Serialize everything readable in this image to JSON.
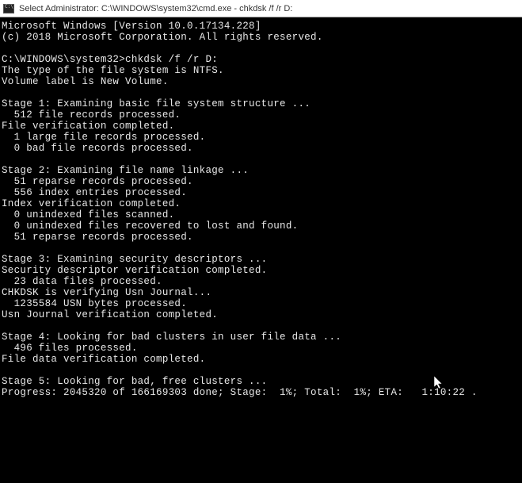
{
  "titlebar": {
    "text": "Select Administrator: C:\\WINDOWS\\system32\\cmd.exe - chkdsk  /f /r D:"
  },
  "console": {
    "line1": "Microsoft Windows [Version 10.0.17134.228]",
    "line2": "(c) 2018 Microsoft Corporation. All rights reserved.",
    "blank1": "",
    "prompt": "C:\\WINDOWS\\system32>chkdsk /f /r D:",
    "fs_type": "The type of the file system is NTFS.",
    "vol_label": "Volume label is New Volume.",
    "blank2": "",
    "stage1_header": "Stage 1: Examining basic file system structure ...",
    "stage1_l1": "  512 file records processed.",
    "stage1_l2": "File verification completed.",
    "stage1_l3": "  1 large file records processed.",
    "stage1_l4": "  0 bad file records processed.",
    "blank3": "",
    "stage2_header": "Stage 2: Examining file name linkage ...",
    "stage2_l1": "  51 reparse records processed.",
    "stage2_l2": "  556 index entries processed.",
    "stage2_l3": "Index verification completed.",
    "stage2_l4": "  0 unindexed files scanned.",
    "stage2_l5": "  0 unindexed files recovered to lost and found.",
    "stage2_l6": "  51 reparse records processed.",
    "blank4": "",
    "stage3_header": "Stage 3: Examining security descriptors ...",
    "stage3_l1": "Security descriptor verification completed.",
    "stage3_l2": "  23 data files processed.",
    "stage3_l3": "CHKDSK is verifying Usn Journal...",
    "stage3_l4": "  1235584 USN bytes processed.",
    "stage3_l5": "Usn Journal verification completed.",
    "blank5": "",
    "stage4_header": "Stage 4: Looking for bad clusters in user file data ...",
    "stage4_l1": "  496 files processed.",
    "stage4_l2": "File data verification completed.",
    "blank6": "",
    "stage5_header": "Stage 5: Looking for bad, free clusters ...",
    "stage5_l1": "Progress: 2045320 of 166169303 done; Stage:  1%; Total:  1%; ETA:   1:10:22 ."
  }
}
